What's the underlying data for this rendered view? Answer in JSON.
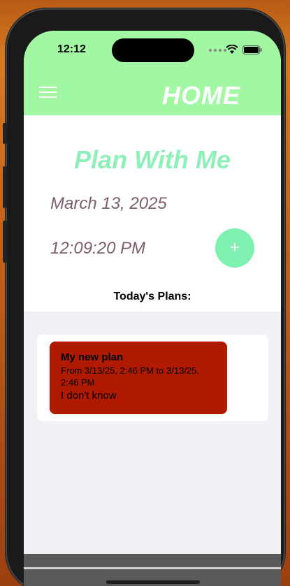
{
  "status_bar": {
    "time": "12:12"
  },
  "header": {
    "title": "HOME",
    "menu_icon": "hamburger-menu-icon"
  },
  "main": {
    "app_title": "Plan With Me",
    "date": "March 13, 2025",
    "time": "12:09:20 PM",
    "add_button_label": "+",
    "plans_heading": "Today's Plans:"
  },
  "plans": [
    {
      "title": "My new plan",
      "range": "From 3/13/25, 2:46 PM to 3/13/25, 2:46 PM",
      "description": "I don't know"
    }
  ],
  "colors": {
    "header_bg": "#a2f7a2",
    "title_green": "#8ef0b8",
    "text_mauve": "#7d5f66",
    "add_button": "#7ef0b0",
    "plan_red": "#b01a00",
    "list_bg": "#f0f0f5"
  }
}
